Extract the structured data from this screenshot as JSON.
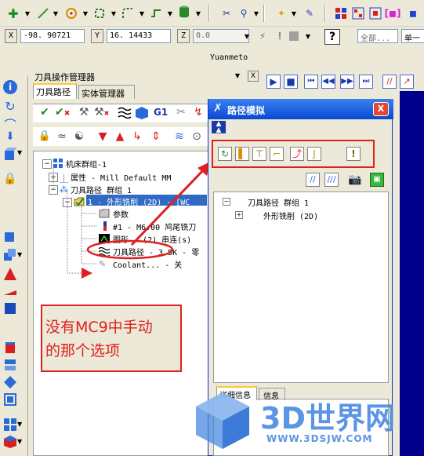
{
  "toolbar2": {
    "x_label": "X",
    "x_value": "-98. 90721",
    "y_label": "Y",
    "y_value": "16. 14433",
    "z_label": "Z",
    "z_value": "0.0",
    "help_icon": "?",
    "level_combo": "全部...",
    "single_combo": "单一"
  },
  "user_label": "Yuanmeto",
  "manager": {
    "title": "刀具操作管理器",
    "pin": "▼",
    "close": "X",
    "tab_toolpath": "刀具路径",
    "tab_solid": "实体管理器",
    "g1": "G1",
    "tree": {
      "machine_group": "机床群组-1",
      "properties": "属性 - Mill Default MM",
      "toolpath_group": "刀具路径 群组 1",
      "op1": "1 - 外形铣削 (2D) - [WC",
      "params": "参数",
      "tool": "#1 - M6.00 鸠尾铣刀",
      "geometry": "图形 - (2) 串连(s)",
      "toolpath": "刀具路径 - 3.5K - 零",
      "coolant": "Coolant... - 关"
    }
  },
  "annotation": {
    "line1": "没有MC9中手动",
    "line2": "的那个选项"
  },
  "dialog": {
    "title": "路径模拟",
    "close": "X",
    "tree_group": "刀具路径 群组 1",
    "tree_op": "外形铣削 (2D)",
    "tab_details": "详细信息",
    "tab_info": "信息"
  },
  "watermark": {
    "brand": "3D世界网",
    "url": "WWW.3DSJW.COM"
  },
  "colors": {
    "viewport_blue": "#00008b",
    "dialog_title_blue": "#2f6fd8",
    "annotation_red": "#e02020"
  }
}
